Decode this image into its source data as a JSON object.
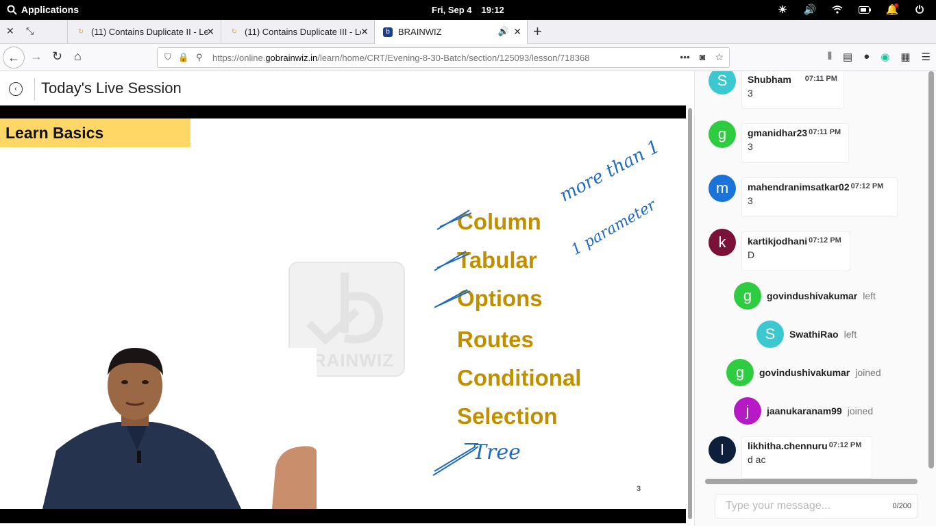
{
  "os": {
    "apps_label": "Applications",
    "date": "Fri, Sep  4",
    "time": "19:12"
  },
  "tabs": [
    {
      "title": "(11) Contains Duplicate II - Le"
    },
    {
      "title": "(11) Contains Duplicate III - Le"
    },
    {
      "title": "BRAINWIZ"
    }
  ],
  "address": {
    "url_prefix": "https://online.",
    "url_domain": "gobrainwiz.in",
    "url_path": "/learn/home/CRT/Evening-8-30-Batch/section/125093/lesson/718368"
  },
  "page": {
    "title": "Today's Live Session"
  },
  "slide": {
    "banner": "Learn Basics",
    "watermark": "BRAINWIZ",
    "items": [
      "Column",
      "Tabular",
      "Options",
      "Routes",
      "Conditional",
      "Selection"
    ],
    "handwriting": [
      "more than 1",
      "1 parameter",
      "Tree"
    ],
    "page_number": "3"
  },
  "chat": {
    "messages": [
      {
        "initial": "S",
        "color": "#3cc8d0",
        "name": "Shubham",
        "time": "07:11 PM",
        "text": "3"
      },
      {
        "initial": "g",
        "color": "#2ecc40",
        "name": "gmanidhar23",
        "time": "07:11 PM",
        "text": "3"
      },
      {
        "initial": "m",
        "color": "#1a73d9",
        "name": "mahendranimsatkar02",
        "time": "07:12 PM",
        "text": "3"
      },
      {
        "initial": "k",
        "color": "#7a1238",
        "name": "kartikjodhani",
        "time": "07:12 PM",
        "text": "D"
      },
      {
        "initial": "l",
        "color": "#0d1f3a",
        "name": "likhitha.chennuru",
        "time": "07:12 PM",
        "text": "d ac"
      }
    ],
    "events": [
      {
        "initial": "g",
        "color": "#2ecc40",
        "name": "govindushivakumar",
        "action": "left"
      },
      {
        "initial": "S",
        "color": "#3cc8d0",
        "name": "SwathiRao",
        "action": "left"
      },
      {
        "initial": "g",
        "color": "#2ecc40",
        "name": "govindushivakumar",
        "action": "joined"
      },
      {
        "initial": "j",
        "color": "#b51ac4",
        "name": "jaanukaranam99",
        "action": "joined"
      }
    ],
    "input_placeholder": "Type your message...",
    "counter": "0/200"
  }
}
